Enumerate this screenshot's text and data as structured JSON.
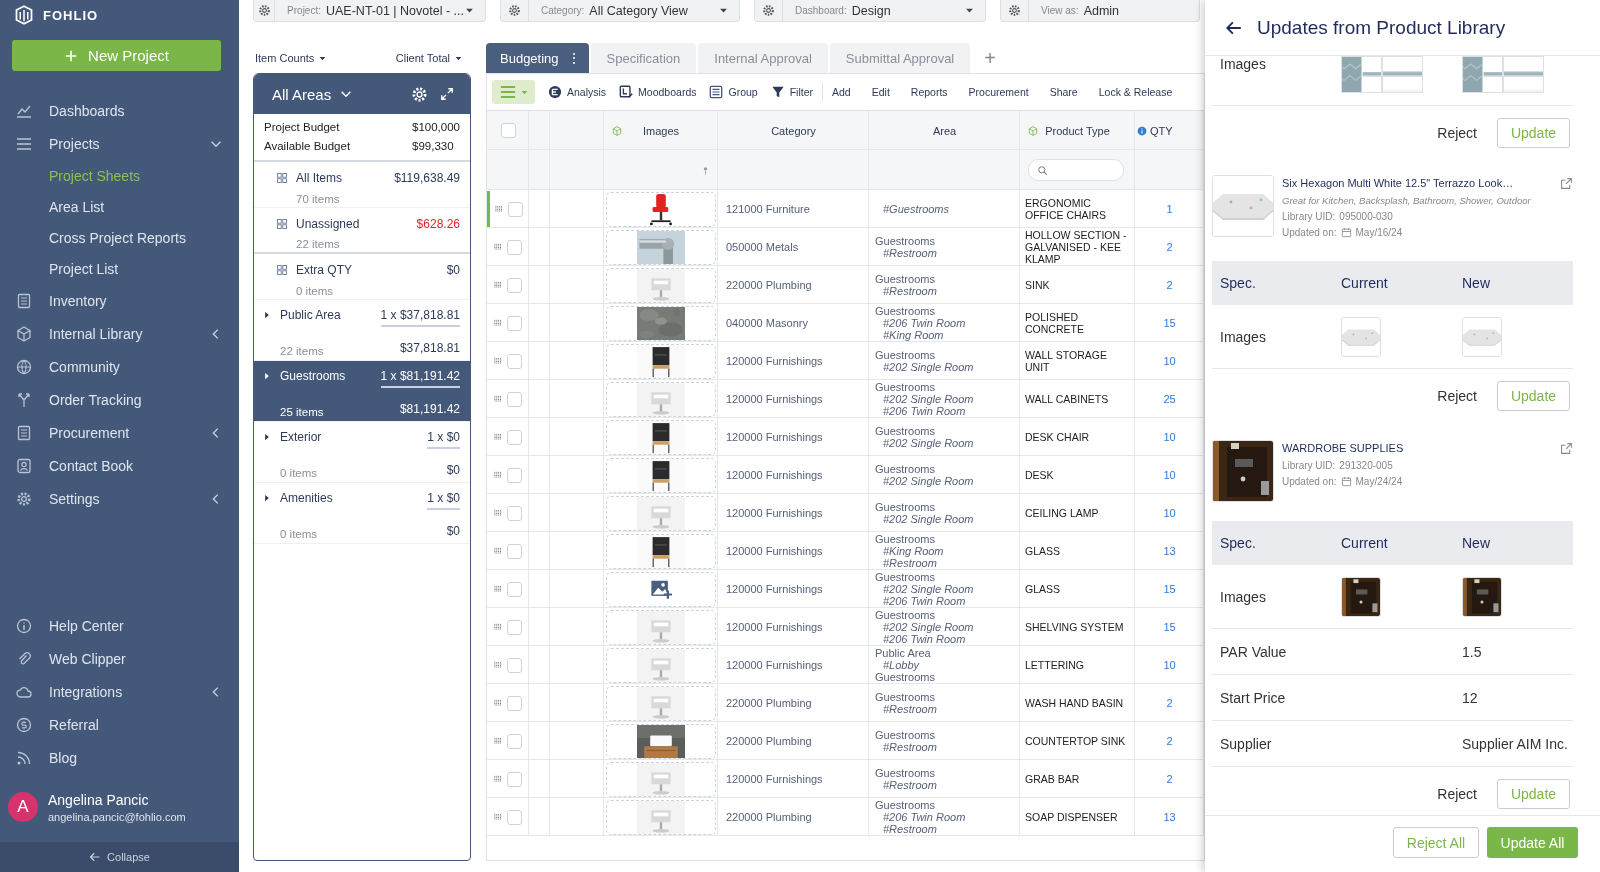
{
  "sidebar": {
    "logo": "FOHLIO",
    "new_project": "New Project",
    "nav": [
      {
        "label": "Dashboards",
        "kind": "link"
      },
      {
        "label": "Projects",
        "kind": "group",
        "expanded": true,
        "children": [
          {
            "label": "Project Sheets",
            "selected": true
          },
          {
            "label": "Area List",
            "selected": false
          },
          {
            "label": "Cross Project Reports",
            "selected": false
          },
          {
            "label": "Project List",
            "selected": false
          }
        ]
      },
      {
        "label": "Inventory",
        "kind": "link"
      },
      {
        "label": "Internal Library",
        "kind": "group",
        "expanded": false
      },
      {
        "label": "Community",
        "kind": "link"
      },
      {
        "label": "Order Tracking",
        "kind": "link"
      },
      {
        "label": "Procurement",
        "kind": "group",
        "expanded": false
      },
      {
        "label": "Contact Book",
        "kind": "link"
      },
      {
        "label": "Settings",
        "kind": "group",
        "expanded": false
      }
    ],
    "bottom_nav": [
      {
        "label": "Help Center",
        "kind": "link"
      },
      {
        "label": "Web Clipper",
        "kind": "link"
      },
      {
        "label": "Integrations",
        "kind": "group",
        "expanded": false
      },
      {
        "label": "Referral",
        "kind": "link"
      },
      {
        "label": "Blog",
        "kind": "link"
      }
    ],
    "user": {
      "initial": "A",
      "name": "Angelina Pancic",
      "email": "angelina.pancic@fohlio.com"
    },
    "collapse": "Collapse"
  },
  "filters": [
    {
      "label": "Project:",
      "value": "UAE-NT-01 | Novotel - ...",
      "dropdown": true
    },
    {
      "label": "Category:",
      "value": "All Category View",
      "dropdown": true
    },
    {
      "label": "Dashboard:",
      "value": "Design",
      "dropdown": true
    },
    {
      "label": "View as:",
      "value": "Admin",
      "dropdown": false
    }
  ],
  "areas_panel": {
    "counts_menu": "Item Counts",
    "totals_menu": "Client Total",
    "title": "All Areas",
    "budget": [
      {
        "label": "Project Budget",
        "value": "$100,000"
      },
      {
        "label": "Available Budget",
        "value": "$99,330"
      }
    ],
    "groups": [
      {
        "label": "All Items",
        "amount": "$119,638.49",
        "count": "70 items",
        "over_budget": false
      },
      {
        "label": "Unassigned",
        "amount": "$628.26",
        "count": "22 items",
        "over_budget": true
      },
      {
        "label": "Extra QTY",
        "amount": "$0",
        "count": "0 items",
        "over_budget": false
      }
    ],
    "areas": [
      {
        "name": "Public Area",
        "formula": "1 x $37,818.81",
        "total": "$37,818.81",
        "count": "22 items",
        "selected": false
      },
      {
        "name": "Guestrooms",
        "formula": "1 x $81,191.42",
        "total": "$81,191.42",
        "count": "25 items",
        "selected": true
      },
      {
        "name": "Exterior",
        "formula": "1 x $0",
        "total": "$0",
        "count": "0 items",
        "selected": false
      },
      {
        "name": "Amenities",
        "formula": "1 x $0",
        "total": "$0",
        "count": "0 items",
        "selected": false
      }
    ]
  },
  "sheet": {
    "tabs": [
      {
        "label": "Budgeting",
        "selected": true,
        "menu": "⋮"
      },
      {
        "label": "Specification",
        "selected": false
      },
      {
        "label": "Internal Approval",
        "selected": false
      },
      {
        "label": "Submittal Approval",
        "selected": false
      }
    ],
    "add_tab": "+",
    "primary_tools": [
      "Analysis",
      "Moodboards",
      "Group",
      "Filter"
    ],
    "secondary_tools": [
      "Add",
      "Edit",
      "Reports",
      "Procurement",
      "Share",
      "Lock & Release"
    ],
    "all_checked": false,
    "columns": [
      "Images",
      "Category",
      "Area",
      "Product Type",
      "QTY"
    ],
    "rows": [
      {
        "image": {
          "kind": "picture"
        },
        "category": "121000 Furniture",
        "area": [
          {
            "kind": "tag",
            "text": "#Guestrooms"
          }
        ],
        "product_type": "ERGONOMIC OFFICE CHAIRS",
        "qty": "1",
        "active": true,
        "checked": false
      },
      {
        "image": {
          "kind": "picture"
        },
        "category": "050000 Metals",
        "area": [
          {
            "kind": "area",
            "text": "Guestrooms"
          },
          {
            "kind": "tag",
            "text": "#Restroom"
          }
        ],
        "product_type": "HOLLOW SECTION - GALVANISED - KEE KLAMP",
        "qty": "2",
        "active": false,
        "checked": false
      },
      {
        "image": {
          "kind": "picture"
        },
        "category": "220000 Plumbing",
        "area": [
          {
            "kind": "area",
            "text": "Guestrooms"
          },
          {
            "kind": "tag",
            "text": "#Restroom"
          }
        ],
        "product_type": "SINK",
        "qty": "2",
        "active": false,
        "checked": false
      },
      {
        "image": {
          "kind": "picture"
        },
        "category": "040000 Masonry",
        "area": [
          {
            "kind": "area",
            "text": "Guestrooms"
          },
          {
            "kind": "tag",
            "text": "#206 Twin Room"
          },
          {
            "kind": "tag",
            "text": "#King Room"
          }
        ],
        "product_type": "POLISHED CONCRETE",
        "qty": "15",
        "active": false,
        "checked": false
      },
      {
        "image": {
          "kind": "picture"
        },
        "category": "120000 Furnishings",
        "area": [
          {
            "kind": "area",
            "text": "Guestrooms"
          },
          {
            "kind": "tag",
            "text": "#202 Single Room"
          }
        ],
        "product_type": "WALL STORAGE UNIT",
        "qty": "10",
        "active": false,
        "checked": false
      },
      {
        "image": {
          "kind": "picture"
        },
        "category": "120000 Furnishings",
        "area": [
          {
            "kind": "area",
            "text": "Guestrooms"
          },
          {
            "kind": "tag",
            "text": "#202 Single Room"
          },
          {
            "kind": "tag",
            "text": "#206 Twin Room"
          }
        ],
        "product_type": "WALL CABINETS",
        "qty": "25",
        "active": false,
        "checked": false
      },
      {
        "image": {
          "kind": "picture"
        },
        "category": "120000 Furnishings",
        "area": [
          {
            "kind": "area",
            "text": "Guestrooms"
          },
          {
            "kind": "tag",
            "text": "#202 Single Room"
          }
        ],
        "product_type": "DESK CHAIR",
        "qty": "10",
        "active": false,
        "checked": false
      },
      {
        "image": {
          "kind": "picture"
        },
        "category": "120000 Furnishings",
        "area": [
          {
            "kind": "area",
            "text": "Guestrooms"
          },
          {
            "kind": "tag",
            "text": "#202 Single Room"
          }
        ],
        "product_type": "DESK",
        "qty": "10",
        "active": false,
        "checked": false
      },
      {
        "image": {
          "kind": "picture"
        },
        "category": "120000 Furnishings",
        "area": [
          {
            "kind": "area",
            "text": "Guestrooms"
          },
          {
            "kind": "tag",
            "text": "#202 Single Room"
          }
        ],
        "product_type": "CEILING LAMP",
        "qty": "10",
        "active": false,
        "checked": false
      },
      {
        "image": {
          "kind": "picture"
        },
        "category": "120000 Furnishings",
        "area": [
          {
            "kind": "area",
            "text": "Guestrooms"
          },
          {
            "kind": "tag",
            "text": "#King Room"
          },
          {
            "kind": "tag",
            "text": "#Restroom"
          }
        ],
        "product_type": "GLASS",
        "qty": "13",
        "active": false,
        "checked": false
      },
      {
        "image": {
          "kind": "add"
        },
        "category": "120000 Furnishings",
        "area": [
          {
            "kind": "area",
            "text": "Guestrooms"
          },
          {
            "kind": "tag",
            "text": "#202 Single Room"
          },
          {
            "kind": "tag",
            "text": "#206 Twin Room"
          }
        ],
        "product_type": "GLASS",
        "qty": "15",
        "active": false,
        "checked": false
      },
      {
        "image": {
          "kind": "picture"
        },
        "category": "120000 Furnishings",
        "area": [
          {
            "kind": "area",
            "text": "Guestrooms"
          },
          {
            "kind": "tag",
            "text": "#202 Single Room"
          },
          {
            "kind": "tag",
            "text": "#206 Twin Room"
          }
        ],
        "product_type": "SHELVING SYSTEM",
        "qty": "15",
        "active": false,
        "checked": false
      },
      {
        "image": {
          "kind": "picture"
        },
        "category": "120000 Furnishings",
        "area": [
          {
            "kind": "area",
            "text": "Public Area"
          },
          {
            "kind": "tag",
            "text": "#Lobby"
          },
          {
            "kind": "area",
            "text": "Guestrooms"
          }
        ],
        "product_type": "LETTERING",
        "qty": "10",
        "active": false,
        "checked": false
      },
      {
        "image": {
          "kind": "picture"
        },
        "category": "220000 Plumbing",
        "area": [
          {
            "kind": "area",
            "text": "Guestrooms"
          },
          {
            "kind": "tag",
            "text": "#Restroom"
          }
        ],
        "product_type": "WASH HAND BASIN",
        "qty": "2",
        "active": false,
        "checked": false
      },
      {
        "image": {
          "kind": "picture"
        },
        "category": "220000 Plumbing",
        "area": [
          {
            "kind": "area",
            "text": "Guestrooms"
          },
          {
            "kind": "tag",
            "text": "#Restroom"
          }
        ],
        "product_type": "COUNTERTOP SINK",
        "qty": "2",
        "active": false,
        "checked": false
      },
      {
        "image": {
          "kind": "picture"
        },
        "category": "120000 Furnishings",
        "area": [
          {
            "kind": "area",
            "text": "Guestrooms"
          },
          {
            "kind": "tag",
            "text": "#Restroom"
          }
        ],
        "product_type": "GRAB BAR",
        "qty": "2",
        "active": false,
        "checked": false
      },
      {
        "image": {
          "kind": "picture"
        },
        "category": "220000 Plumbing",
        "area": [
          {
            "kind": "area",
            "text": "Guestrooms"
          },
          {
            "kind": "tag",
            "text": "#206 Twin Room"
          },
          {
            "kind": "tag",
            "text": "#Restroom"
          }
        ],
        "product_type": "SOAP DISPENSER",
        "qty": "13",
        "active": false,
        "checked": false
      }
    ]
  },
  "updates_panel": {
    "title": "Updates from Product Library",
    "updates": [
      {
        "specs": [
          {
            "kind": "images",
            "label": "Images",
            "current": [
              {
                "kind": "picture"
              },
              {
                "kind": "picture"
              }
            ],
            "new": [
              {
                "kind": "picture"
              },
              {
                "kind": "picture"
              }
            ]
          }
        ],
        "reject": "Reject",
        "update": "Update"
      },
      {
        "product": {
          "title": "Six Hexagon Multi White 12.5\" Terrazzo Look…",
          "description": "Great for Kitchen, Backsplash, Bathroom, Shower, Outdoor",
          "uid_label": "Library UID:",
          "uid": "095000-030",
          "date_label": "Updated on:",
          "date": "May/16/24"
        },
        "columns": [
          "Spec.",
          "Current",
          "New"
        ],
        "specs": [
          {
            "kind": "images",
            "label": "Images",
            "current": [
              {
                "kind": "picture"
              }
            ],
            "new": [
              {
                "kind": "picture"
              }
            ]
          }
        ],
        "reject": "Reject",
        "update": "Update"
      },
      {
        "product": {
          "title": "WARDROBE SUPPLIES",
          "uid_label": "Library UID:",
          "uid": "291320-005",
          "date_label": "Updated on:",
          "date": "May/24/24"
        },
        "columns": [
          "Spec.",
          "Current",
          "New"
        ],
        "specs": [
          {
            "kind": "images",
            "label": "Images",
            "current": [
              {
                "kind": "picture"
              }
            ],
            "new": [
              {
                "kind": "picture"
              }
            ]
          },
          {
            "kind": "text",
            "label": "PAR Value",
            "new": "1.5"
          },
          {
            "kind": "text",
            "label": "Start Price",
            "new": "12"
          },
          {
            "kind": "text",
            "label": "Supplier",
            "new": "Supplier AIM Inc."
          }
        ],
        "reject": "Reject",
        "update": "Update"
      }
    ],
    "reject_all": "Reject All",
    "update_all": "Update All"
  }
}
